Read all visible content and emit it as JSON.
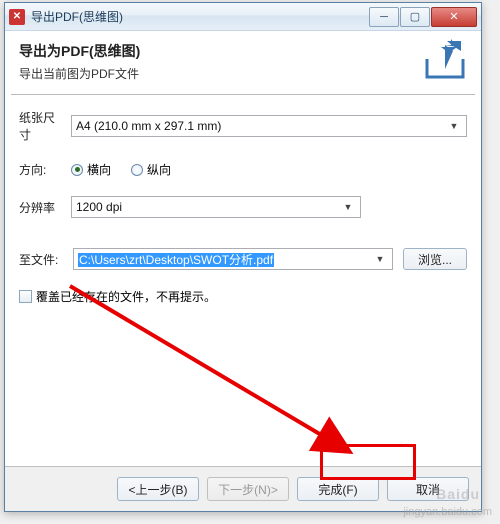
{
  "window": {
    "title": "导出PDF(思维图)"
  },
  "header": {
    "heading": "导出为PDF(思维图)",
    "subtitle": "导出当前图为PDF文件"
  },
  "form": {
    "paper_label": "纸张尺寸",
    "paper_value": "A4 (210.0 mm x 297.1 mm)",
    "orient_label": "方向:",
    "orient_landscape": "横向",
    "orient_portrait": "纵向",
    "orient_selected": "landscape",
    "reso_label": "分辨率",
    "reso_value": "1200 dpi",
    "file_label": "至文件:",
    "file_value": "C:\\Users\\zrt\\Desktop\\SWOT分析.pdf",
    "browse": "浏览...",
    "overwrite_label": "覆盖已经存在的文件，不再提示。"
  },
  "footer": {
    "back": "<上一步(B)",
    "next": "下一步(N)>",
    "finish": "完成(F)",
    "cancel": "取消"
  },
  "watermark": {
    "main": "Baidu",
    "sub": "jingyan.baidu.com"
  }
}
